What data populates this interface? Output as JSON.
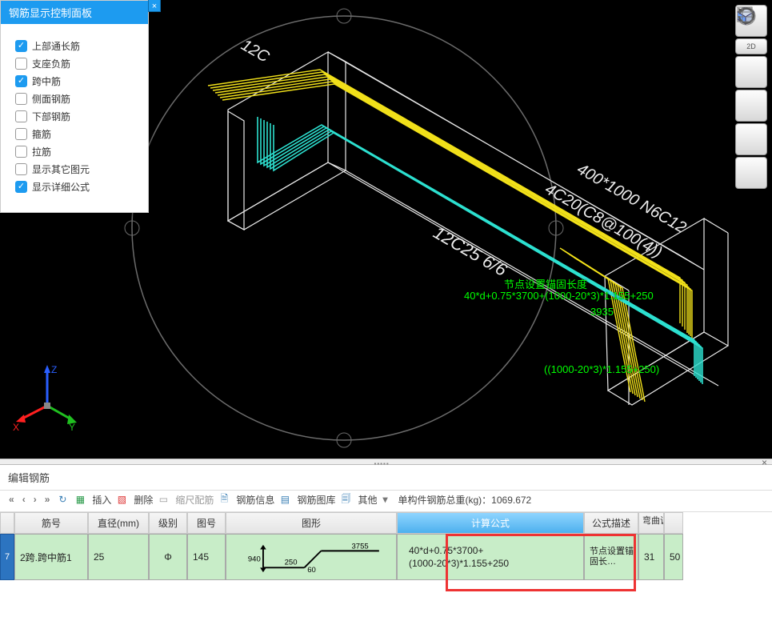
{
  "panel": {
    "title": "钢筋显示控制面板",
    "items": [
      {
        "label": "上部通长筋",
        "checked": true
      },
      {
        "label": "支座负筋",
        "checked": false
      },
      {
        "label": "跨中筋",
        "checked": true
      },
      {
        "label": "侧面钢筋",
        "checked": false
      },
      {
        "label": "下部钢筋",
        "checked": false
      },
      {
        "label": "箍筋",
        "checked": false
      },
      {
        "label": "拉筋",
        "checked": false
      },
      {
        "label": "显示其它图元",
        "checked": false
      },
      {
        "label": "显示详细公式",
        "checked": true
      }
    ]
  },
  "viewcube": {
    "twoD": "2D"
  },
  "annotations": {
    "sec1": "12C25 6/6",
    "sec2": "4C20(C8@100(4))",
    "sec3": "400*1000 N6C12",
    "node1a": "节点设置锚固长度",
    "node1b": "40*d+0.75*3700+(1000-20*3)*1.155+250",
    "node1c": "3935",
    "node2": "((1000-20*3)*1.155+250)",
    "topDim": "12C"
  },
  "bottom": {
    "title": "编辑钢筋",
    "toolbar": {
      "insert": "插入",
      "delete": "删除",
      "scale": "缩尺配筋",
      "info": "钢筋信息",
      "library": "钢筋图库",
      "other": "其他",
      "weightLabel": "单构件钢筋总重(kg)：",
      "weightValue": "1069.672"
    },
    "headers": {
      "h1": "筋号",
      "h2": "直径(mm)",
      "h3": "级别",
      "h4": "图号",
      "h5": "图形",
      "h6": "计算公式",
      "h7": "公式描述",
      "h8": "弯曲调整"
    },
    "row": {
      "num": "7",
      "name": "2跨.跨中筋1",
      "dia": "25",
      "grade": "Φ",
      "shapeNo": "145",
      "shape": {
        "a": "940",
        "b": "250",
        "c": "60",
        "d": "3755"
      },
      "formula_l1": "40*d+0.75*3700+",
      "formula_l2": "(1000-20*3)*1.155+250",
      "desc": "节点设置锚固长…",
      "bend": "31",
      "extra": "50"
    }
  }
}
